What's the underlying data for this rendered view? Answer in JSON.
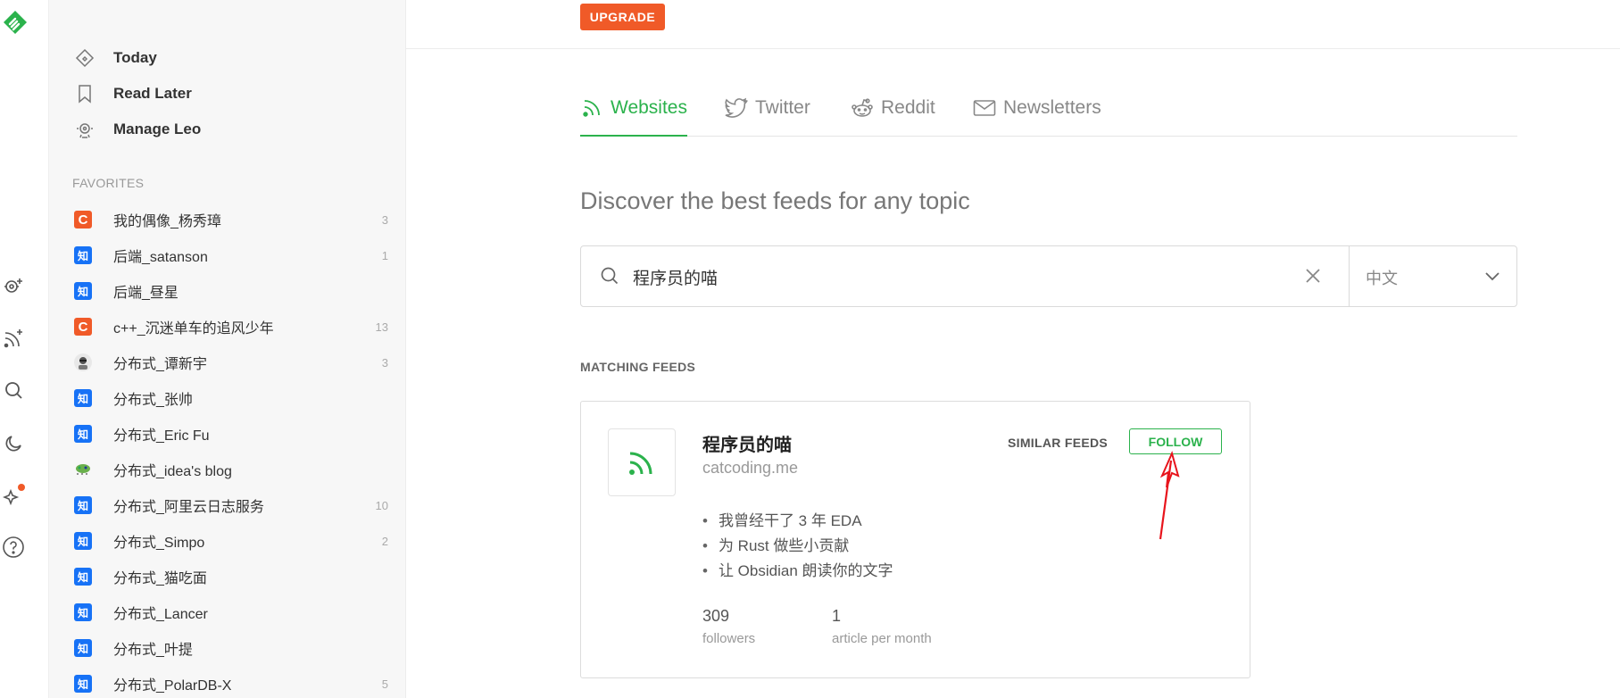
{
  "nav": [
    {
      "label": "Today"
    },
    {
      "label": "Read Later"
    },
    {
      "label": "Manage Leo"
    }
  ],
  "favorites": {
    "title": "FAVORITES",
    "items": [
      {
        "icon": "C",
        "name": "我的偶像_杨秀璋",
        "count": "3"
      },
      {
        "icon": "知",
        "name": "后端_satanson",
        "count": "1"
      },
      {
        "icon": "知",
        "name": "后端_昼星",
        "count": ""
      },
      {
        "icon": "C",
        "name": "c++_沉迷单车的追风少年",
        "count": "13"
      },
      {
        "icon": "avatar",
        "name": "分布式_谭新宇",
        "count": "3"
      },
      {
        "icon": "知",
        "name": "分布式_张帅",
        "count": ""
      },
      {
        "icon": "知",
        "name": "分布式_Eric Fu",
        "count": ""
      },
      {
        "icon": "bug",
        "name": "分布式_idea's blog",
        "count": ""
      },
      {
        "icon": "知",
        "name": "分布式_阿里云日志服务",
        "count": "10"
      },
      {
        "icon": "知",
        "name": "分布式_Simpo",
        "count": "2"
      },
      {
        "icon": "知",
        "name": "分布式_猫吃面",
        "count": ""
      },
      {
        "icon": "知",
        "name": "分布式_Lancer",
        "count": ""
      },
      {
        "icon": "知",
        "name": "分布式_叶提",
        "count": ""
      },
      {
        "icon": "知",
        "name": "分布式_PolarDB-X",
        "count": "5"
      }
    ]
  },
  "rail_icons": [
    "feedly-logo",
    "leo-add-icon",
    "rss-add-icon",
    "search-icon",
    "moon-icon",
    "sparkle-icon",
    "help-icon"
  ],
  "upgrade_label": "UPGRADE",
  "tabs": [
    {
      "label": "Websites",
      "icon": "rss-icon",
      "active": true
    },
    {
      "label": "Twitter",
      "icon": "twitter-icon",
      "active": false
    },
    {
      "label": "Reddit",
      "icon": "reddit-icon",
      "active": false
    },
    {
      "label": "Newsletters",
      "icon": "mail-icon",
      "active": false
    }
  ],
  "headline": "Discover the best feeds for any topic",
  "search": {
    "value": "程序员的喵",
    "language": "中文"
  },
  "matching_title": "MATCHING FEEDS",
  "feed": {
    "name": "程序员的喵",
    "url": "catcoding.me",
    "similar_label": "SIMILAR FEEDS",
    "follow_label": "FOLLOW",
    "articles": [
      "我曾经干了 3 年 EDA",
      "为 Rust 做些小贡献",
      "让 Obsidian 朗读你的文字"
    ],
    "followers_value": "309",
    "followers_label": "followers",
    "frequency_value": "1",
    "frequency_label": "article per month"
  },
  "colors": {
    "accent": "#2bb24c",
    "upgrade": "#f05a28",
    "zhihu": "#1772f6",
    "annotation": "#e8141c"
  }
}
